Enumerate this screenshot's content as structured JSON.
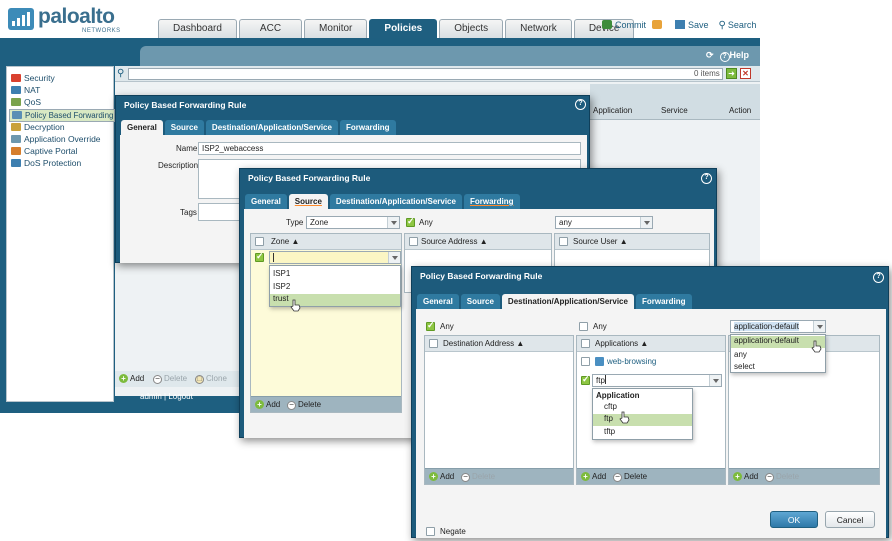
{
  "brand": {
    "name": "paloalto",
    "sub": "NETWORKS"
  },
  "tabs": [
    "Dashboard",
    "ACC",
    "Monitor",
    "Policies",
    "Objects",
    "Network",
    "Device"
  ],
  "toolbar": {
    "commit": "Commit",
    "save": "Save",
    "search": "Search",
    "help": "Help",
    "items": "0 items"
  },
  "nav": [
    "Security",
    "NAT",
    "QoS",
    "Policy Based Forwarding",
    "Decryption",
    "Application Override",
    "Captive Portal",
    "DoS Protection"
  ],
  "grid": {
    "headers": [
      "Application",
      "Service",
      "Action"
    ]
  },
  "bottom": {
    "add": "Add",
    "delete": "Delete",
    "clone": "Clone"
  },
  "status": {
    "user": "admin",
    "logout": "Logout"
  },
  "dialog_title": "Policy Based Forwarding Rule",
  "dialog_tabs": [
    "General",
    "Source",
    "Destination/Application/Service",
    "Forwarding"
  ],
  "general": {
    "name_label": "Name",
    "name_value": "ISP2_webaccess",
    "desc_label": "Description",
    "tags_label": "Tags"
  },
  "source": {
    "type_label": "Type",
    "type_value": "Zone",
    "zone_header": "Zone",
    "zone_options": [
      "ISP1",
      "ISP2",
      "trust"
    ],
    "any": "Any",
    "address_header": "Source Address",
    "user_value": "any",
    "user_header": "Source User",
    "add": "Add",
    "delete": "Delete"
  },
  "dest": {
    "any": "Any",
    "dest_header": "Destination Address",
    "app_any": "Any",
    "app_header": "Applications",
    "app_item": "web-browsing",
    "app_input": "ftp",
    "app_group": "Application",
    "app_options": [
      "cftp",
      "ftp",
      "tftp"
    ],
    "service_value": "application-default",
    "service_options": [
      "application-default",
      "any",
      "select"
    ],
    "add": "Add",
    "delete": "Delete",
    "negate": "Negate",
    "ok": "OK",
    "cancel": "Cancel"
  },
  "colors": {
    "header_blue": "#1e5f80",
    "accent_green": "#8ec643",
    "tab_blue": "#2f7aa0"
  }
}
